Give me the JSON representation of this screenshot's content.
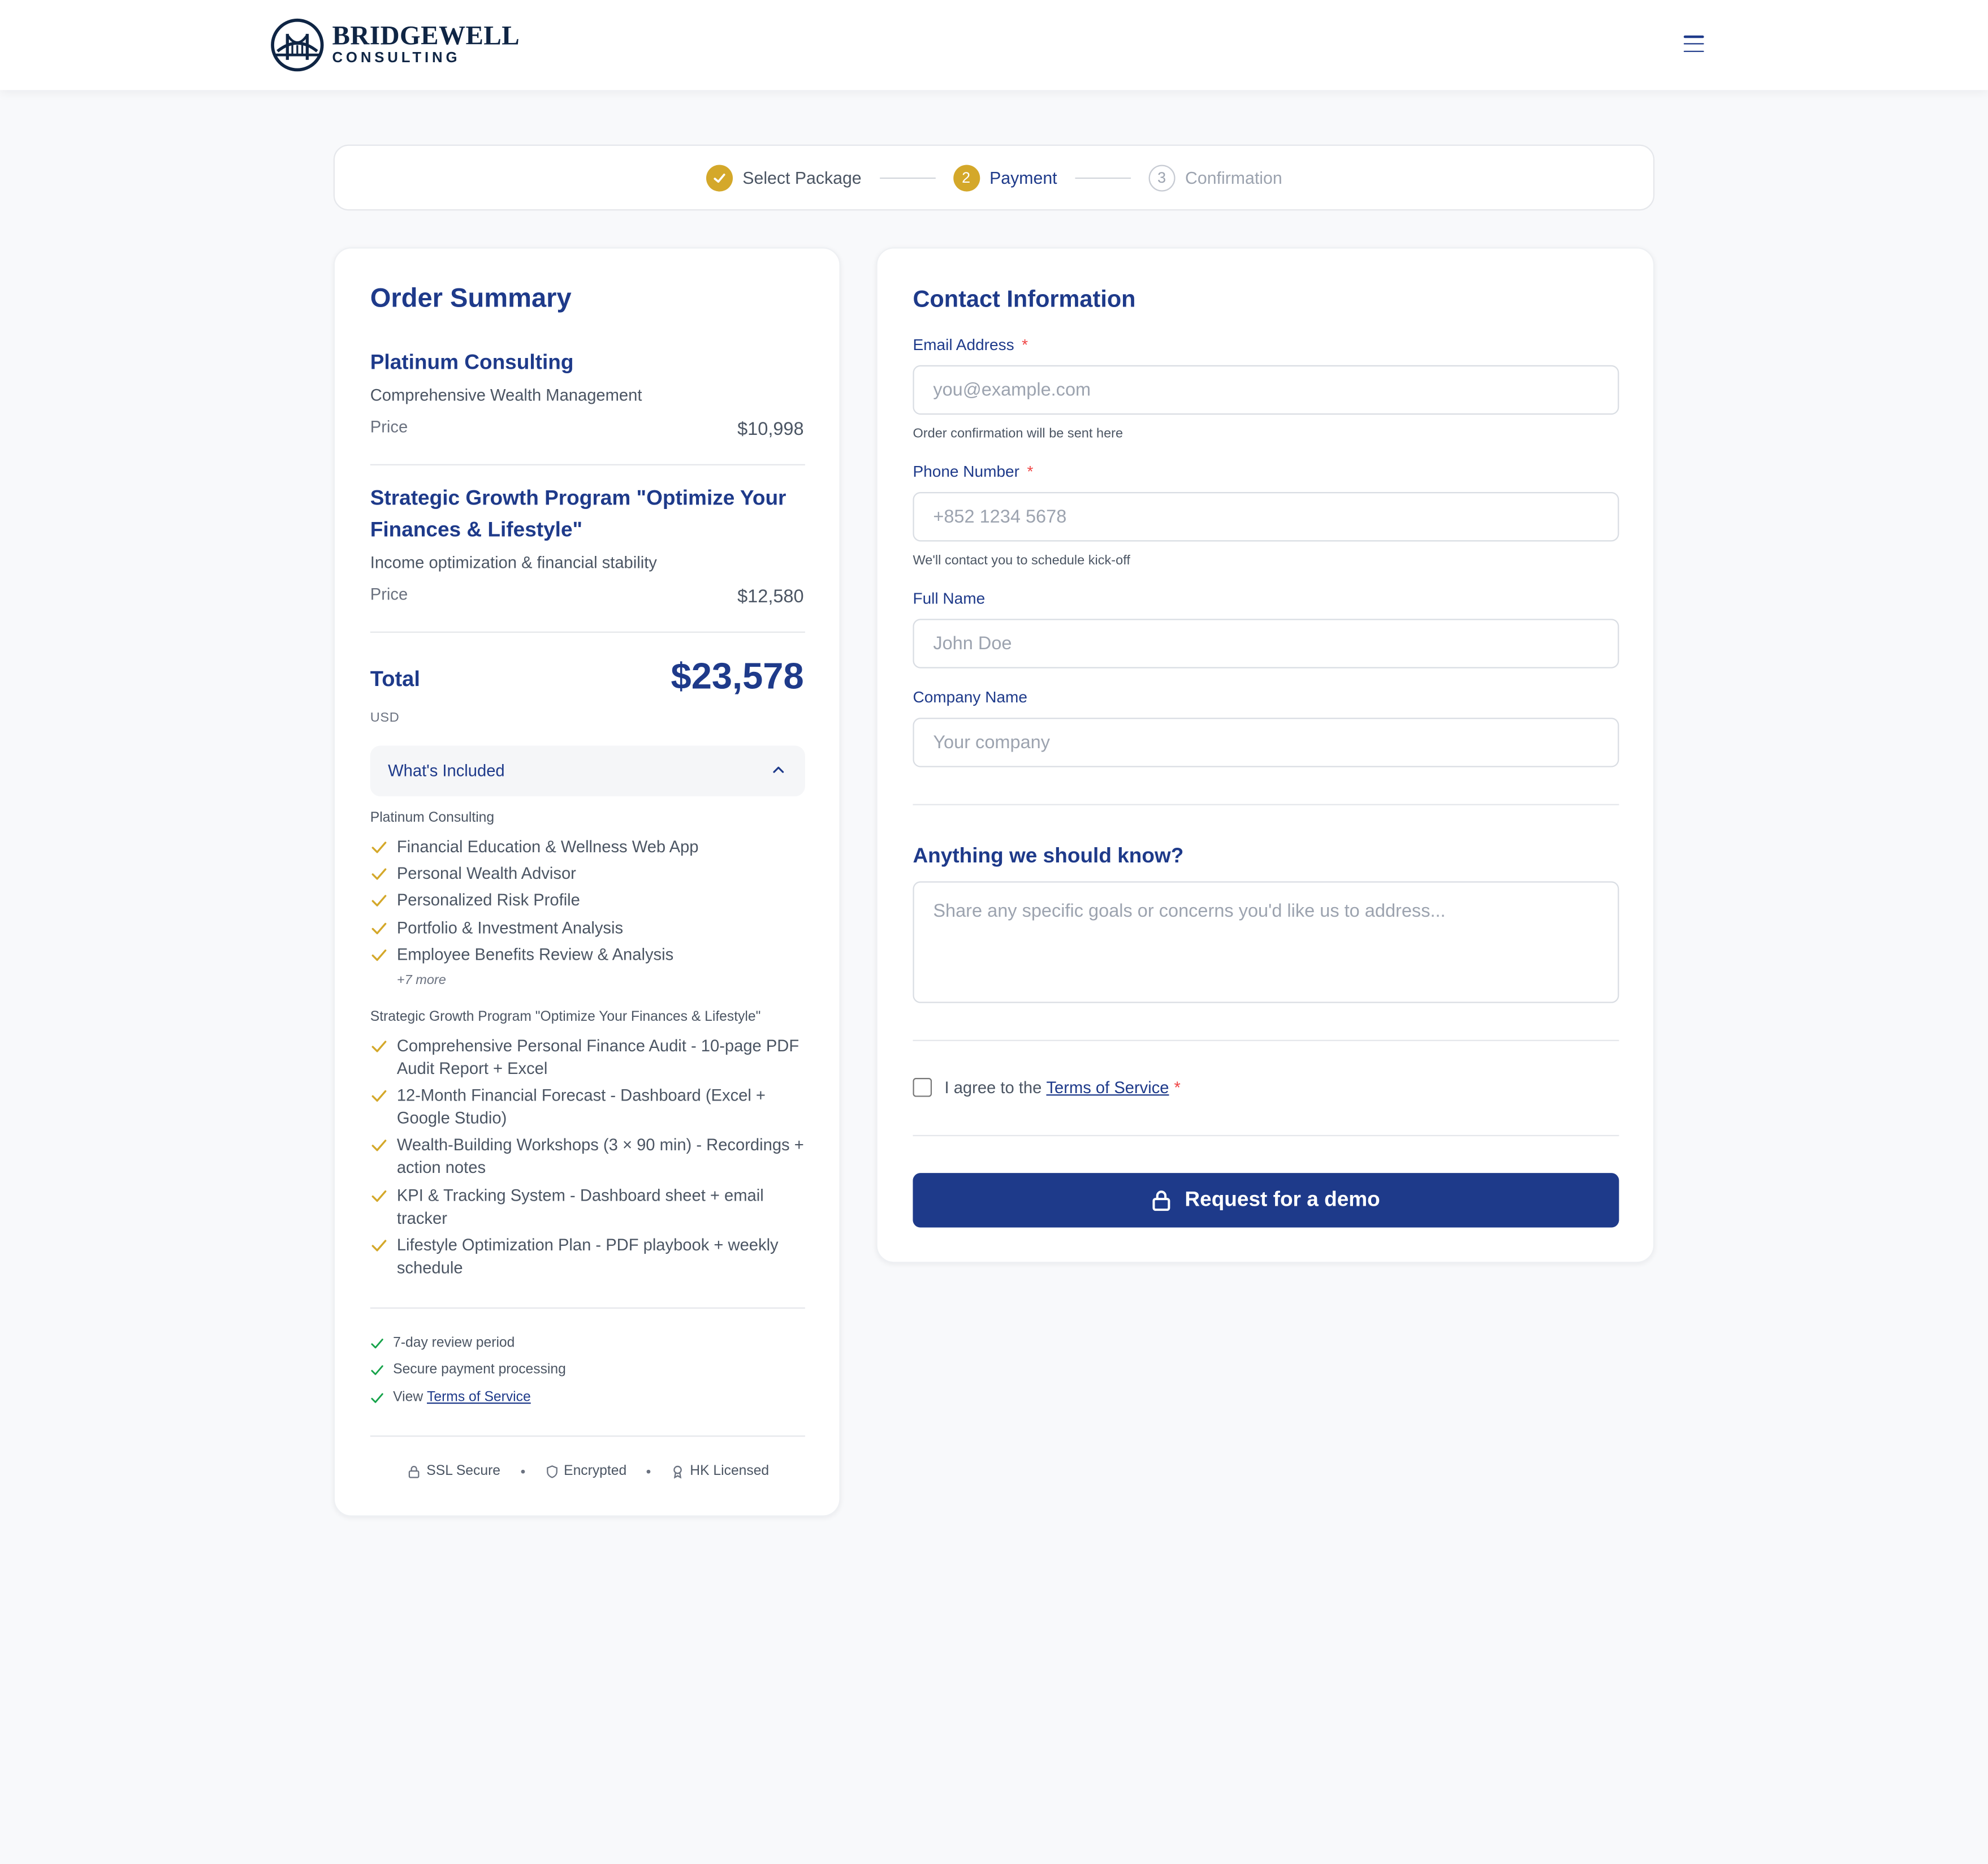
{
  "brand": {
    "name": "BRIDGEWELL",
    "sub": "CONSULTING"
  },
  "stepper": {
    "steps": [
      {
        "label": "Select Package",
        "state": "done"
      },
      {
        "label": "Payment",
        "number": "2",
        "state": "active"
      },
      {
        "label": "Confirmation",
        "number": "3",
        "state": "todo"
      }
    ]
  },
  "summary": {
    "title": "Order Summary",
    "packages": [
      {
        "title": "Platinum Consulting",
        "subtitle": "Comprehensive Wealth Management",
        "price_label": "Price",
        "price": "$10,998"
      },
      {
        "title": "Strategic Growth Program \"Optimize Your Finances & Lifestyle\"",
        "subtitle": "Income optimization & financial stability",
        "price_label": "Price",
        "price": "$12,580"
      }
    ],
    "total_label": "Total",
    "total": "$23,578",
    "currency": "USD",
    "included_label": "What's Included",
    "groups": [
      {
        "label": "Platinum Consulting",
        "items": [
          "Financial Education & Wellness Web App",
          "Personal Wealth Advisor",
          "Personalized Risk Profile",
          "Portfolio & Investment Analysis",
          "Employee Benefits Review & Analysis"
        ],
        "more": "+7 more"
      },
      {
        "label": "Strategic Growth Program \"Optimize Your Finances & Lifestyle\"",
        "items": [
          "Comprehensive Personal Finance Audit - 10-page PDF Audit Report + Excel",
          "12-Month Financial Forecast - Dashboard (Excel + Google Studio)",
          "Wealth-Building Workshops (3 × 90 min) - Recordings + action notes",
          "KPI & Tracking System - Dashboard sheet + email tracker",
          "Lifestyle Optimization Plan - PDF playbook + weekly schedule"
        ]
      }
    ],
    "assurances": [
      "7-day review period",
      "Secure payment processing"
    ],
    "view_prefix": "View",
    "terms_link": "Terms of Service",
    "badges": [
      "SSL Secure",
      "Encrypted",
      "HK Licensed"
    ]
  },
  "contact": {
    "title": "Contact Information",
    "email": {
      "label": "Email Address",
      "placeholder": "you@example.com",
      "help": "Order confirmation will be sent here",
      "value": ""
    },
    "phone": {
      "label": "Phone Number",
      "placeholder": "+852 1234 5678",
      "help": "We'll contact you to schedule kick-off",
      "value": ""
    },
    "name": {
      "label": "Full Name",
      "placeholder": "John Doe",
      "value": ""
    },
    "company": {
      "label": "Company Name",
      "placeholder": "Your company",
      "value": ""
    },
    "notes_title": "Anything we should know?",
    "notes_placeholder": "Share any specific goals or concerns you'd like us to address...",
    "agree_prefix": "I agree to the",
    "agree_link": "Terms of Service",
    "required_mark": "*",
    "cta": "Request for a demo"
  },
  "colors": {
    "primary": "#1e3a8a",
    "accent": "#d4a82a",
    "required": "#ef4444",
    "success": "#16a34a"
  }
}
